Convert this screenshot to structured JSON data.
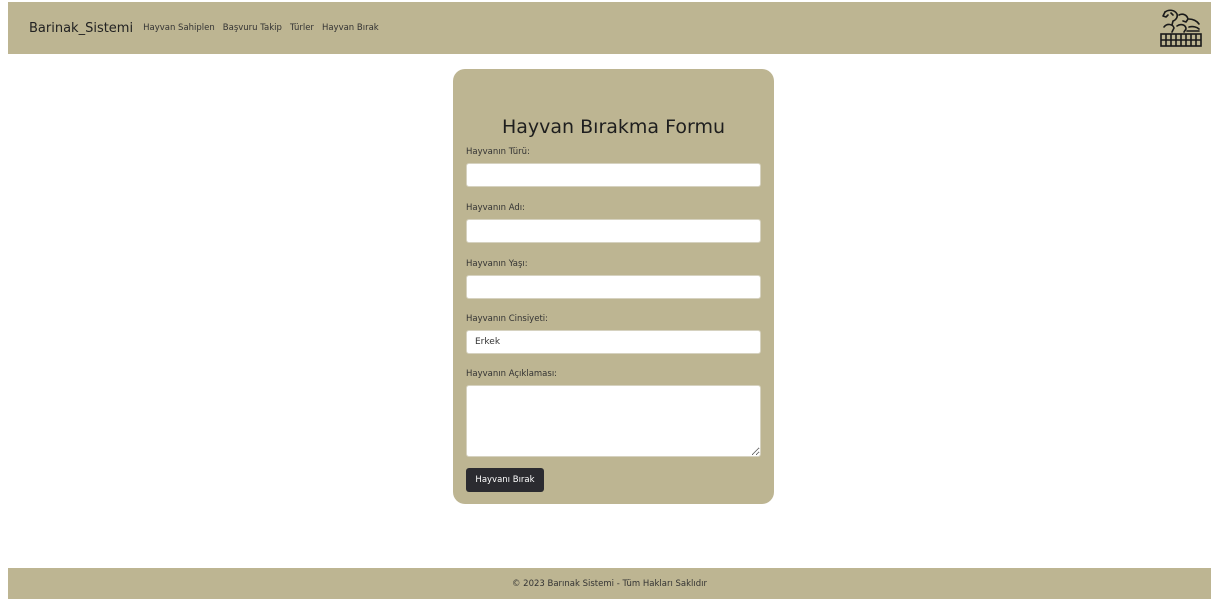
{
  "navbar": {
    "brand": "Barinak_Sistemi",
    "links": [
      "Hayvan Sahiplen",
      "Başvuru Takip",
      "Türler",
      "Hayvan Bırak"
    ],
    "logo_icon": "horse-stable-icon",
    "background_color": "#bdb592"
  },
  "form": {
    "title": "Hayvan Bırakma Formu",
    "fields": {
      "type_label": "Hayvanın Türü:",
      "type_value": "",
      "name_label": "Hayvanın Adı:",
      "name_value": "",
      "age_label": "Hayvanın Yaşı:",
      "age_value": "",
      "gender_label": "Hayvanın Cinsiyeti:",
      "gender_value": "Erkek",
      "description_label": "Hayvanın Açıklaması:",
      "description_value": ""
    },
    "submit_label": "Hayvanı Bırak",
    "card_color": "#bdb592",
    "button_color": "#2b2b30"
  },
  "footer": {
    "text": "© 2023 Barınak Sistemi - Tüm Hakları Saklıdır"
  }
}
